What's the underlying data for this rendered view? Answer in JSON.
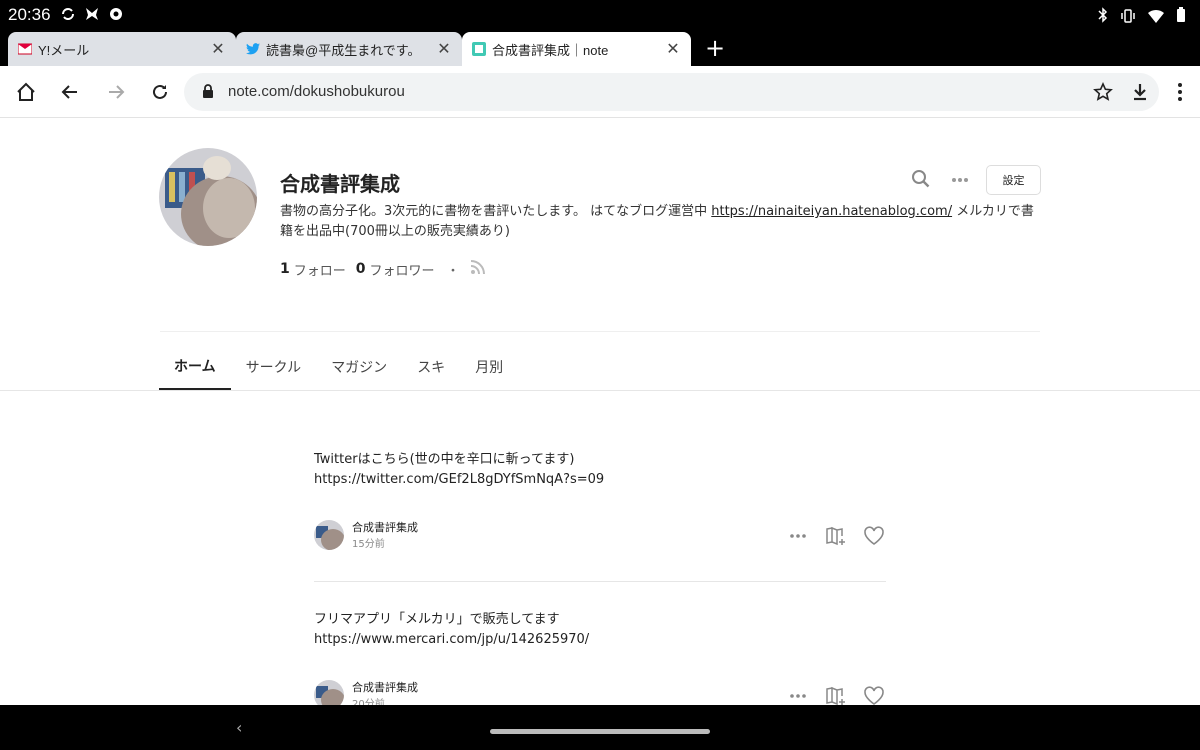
{
  "status_bar": {
    "time": "20:36"
  },
  "tabs": [
    {
      "title": "Y!メール",
      "favicon": "ymail-icon"
    },
    {
      "title": "読書梟@平成生まれです。",
      "favicon": "twitter-icon"
    },
    {
      "title": "合成書評集成｜note",
      "favicon": "note-icon",
      "active": true
    }
  ],
  "address_bar": {
    "url": "note.com/dokushobukurou"
  },
  "profile": {
    "name": "合成書評集成",
    "bio_pre": "書物の高分子化。3次元的に書物を書評いたします。 はてなブログ運営中 ",
    "bio_link": "https://nainaiteiyan.hatenablog.com/",
    "bio_post": " メルカリで書籍を出品中(700冊以上の販売実績あり)",
    "following_count": "1",
    "following_label": "フォロー",
    "followers_count": "0",
    "followers_label": "フォロワー",
    "dot": "・",
    "settings_label": "設定"
  },
  "nav_tabs": [
    "ホーム",
    "サークル",
    "マガジン",
    "スキ",
    "月別"
  ],
  "posts": [
    {
      "body": "Twitterはこちら(世の中を辛口に斬ってます)\nhttps://twitter.com/GEf2L8gDYfSmNqA?s=09",
      "author": "合成書評集成",
      "time": "15分前"
    },
    {
      "body": "フリマアプリ「メルカリ」で販売してます\nhttps://www.mercari.com/jp/u/142625970/",
      "author": "合成書評集成",
      "time": "20分前"
    }
  ],
  "colors": {
    "accent": "#222222",
    "tab_inactive": "#dee1e6",
    "omnibox": "#f1f3f4"
  }
}
